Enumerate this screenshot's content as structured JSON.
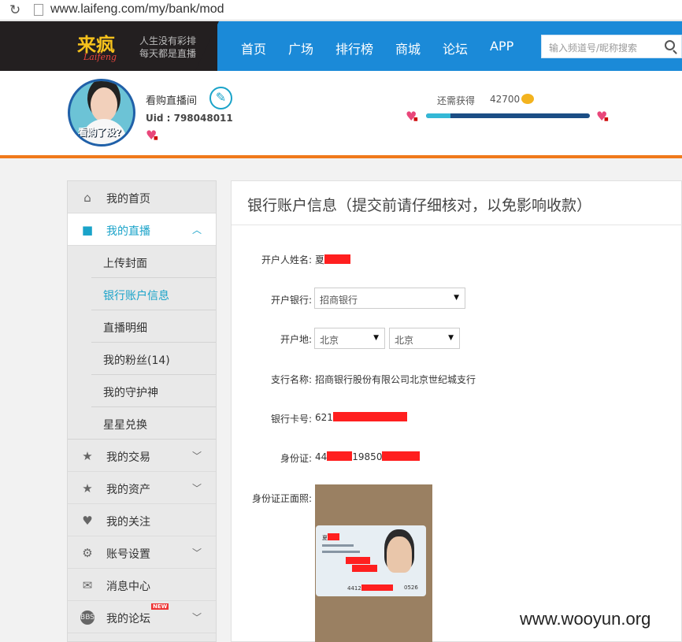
{
  "browser": {
    "url": "www.laifeng.com/my/bank/mod"
  },
  "header": {
    "logo_text": "来疯",
    "slogan_line1": "人生没有彩排",
    "slogan_line2": "每天都是直播",
    "nav": [
      "首页",
      "广场",
      "排行榜",
      "商城",
      "论坛",
      "APP"
    ],
    "search_placeholder": "输入频道号/昵称搜索"
  },
  "profile": {
    "room_name": "看购直播间",
    "uid": "Uid : 798048011",
    "avatar_caption": "看购了没?",
    "need_label": "还需获得",
    "need_value": "42700",
    "progress_fraction": 0.15
  },
  "sidebar": {
    "items": [
      {
        "label": "我的首页",
        "icon": "home-icon"
      },
      {
        "label": "我的直播",
        "icon": "camera-icon"
      },
      {
        "label": "我的交易",
        "icon": "star-icon"
      },
      {
        "label": "我的资产",
        "icon": "star-icon"
      },
      {
        "label": "我的关注",
        "icon": "heart-icon"
      },
      {
        "label": "账号设置",
        "icon": "gear-icon"
      },
      {
        "label": "消息中心",
        "icon": "mail-icon"
      },
      {
        "label": "我的论坛",
        "icon": "bbs-icon",
        "badge": "NEW"
      }
    ],
    "sub": [
      "上传封面",
      "银行账户信息",
      "直播明细",
      "我的粉丝(14)",
      "我的守护神",
      "星星兑换"
    ]
  },
  "form": {
    "title": "银行账户信息（提交前请仔细核对，以免影响收款）",
    "name_label": "开户人姓名:",
    "name_value": "夏",
    "bank_label": "开户银行:",
    "bank_value": "招商银行",
    "place_label": "开户地:",
    "province": "北京",
    "city": "北京",
    "branch_label": "支行名称:",
    "branch_value": "招商银行股份有限公司北京世纪城支行",
    "card_label": "银行卡号:",
    "card_value": "621",
    "id_label": "身份证:",
    "id_value_a": "44",
    "id_value_b": "19850",
    "photo_label": "身份证正面照:",
    "id_card_name": "夏",
    "id_card_num": "4412",
    "id_card_num_tail": "0526"
  },
  "watermark": "www.wooyun.org",
  "colors": {
    "nav_bg": "#1b8ad8",
    "accent": "#1aa3c9",
    "orange_rule": "#f0791b",
    "redaction": "#ff1f1f"
  }
}
